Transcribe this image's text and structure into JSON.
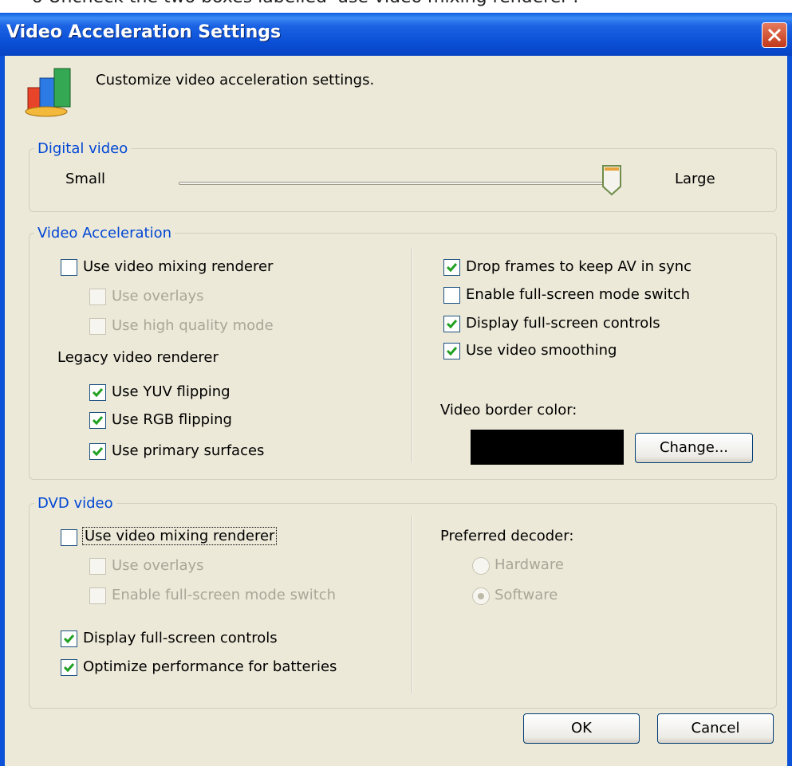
{
  "window": {
    "title": "Video Acceleration Settings"
  },
  "header": {
    "text": "Customize video acceleration settings."
  },
  "digital_video": {
    "legend": "Digital video",
    "min_label": "Small",
    "max_label": "Large",
    "slider_value": 1.0
  },
  "video_acceleration": {
    "legend": "Video Acceleration",
    "use_vmr": {
      "label": "Use video mixing renderer",
      "checked": false
    },
    "use_overlays": {
      "label": "Use overlays",
      "checked": false,
      "disabled": true
    },
    "use_hq_mode": {
      "label": "Use high quality mode",
      "checked": false,
      "disabled": true
    },
    "legacy_label": "Legacy video renderer",
    "use_yuv": {
      "label": "Use YUV flipping",
      "checked": true
    },
    "use_rgb": {
      "label": "Use RGB flipping",
      "checked": true
    },
    "use_primary": {
      "label": "Use primary surfaces",
      "checked": true
    },
    "drop_frames": {
      "label": "Drop frames to keep AV in sync",
      "checked": true
    },
    "fullscreen_switch": {
      "label": "Enable full-screen mode switch",
      "checked": false
    },
    "fullscreen_controls": {
      "label": "Display full-screen controls",
      "checked": true
    },
    "smoothing": {
      "label": "Use video smoothing",
      "checked": true
    },
    "border_color_label": "Video border color:",
    "border_color": "#000000",
    "change_button": "Change..."
  },
  "dvd_video": {
    "legend": "DVD video",
    "use_vmr": {
      "label": "Use video mixing renderer",
      "checked": false
    },
    "use_overlays": {
      "label": "Use overlays",
      "checked": false,
      "disabled": true
    },
    "fullscreen_switch": {
      "label": "Enable full-screen mode switch",
      "checked": false,
      "disabled": true
    },
    "fullscreen_controls": {
      "label": "Display full-screen controls",
      "checked": true
    },
    "optimize_batteries": {
      "label": "Optimize performance for batteries",
      "checked": true
    },
    "decoder_label": "Preferred decoder:",
    "hardware": {
      "label": "Hardware",
      "selected": false,
      "disabled": true
    },
    "software": {
      "label": "Software",
      "selected": true,
      "disabled": true
    }
  },
  "buttons": {
    "ok": "OK",
    "cancel": "Cancel"
  },
  "colors": {
    "title_bar": "#0a4fd6",
    "dialog_bg": "#ece9d8",
    "legend_text": "#0046d5",
    "check": "#21a121"
  }
}
